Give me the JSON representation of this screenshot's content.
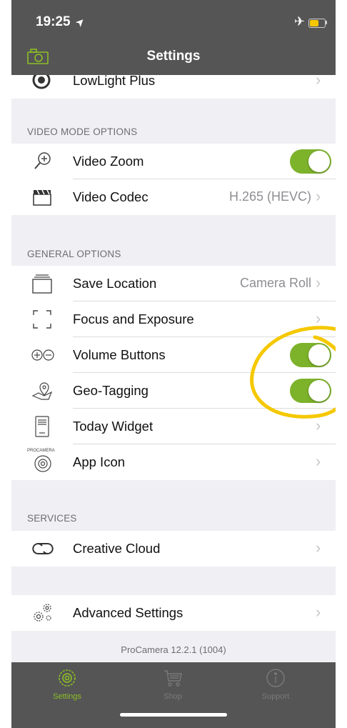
{
  "status_bar": {
    "time": "19:25",
    "location_glyph": "➤",
    "airplane_glyph": "✈"
  },
  "nav": {
    "title": "Settings",
    "left_icon": "camera-icon"
  },
  "partial_row": {
    "label": "LowLight Plus"
  },
  "sections": {
    "video": {
      "header": "VIDEO MODE OPTIONS",
      "zoom_label": "Video Zoom",
      "zoom_on": true,
      "codec_label": "Video Codec",
      "codec_value": "H.265 (HEVC)"
    },
    "general": {
      "header": "GENERAL OPTIONS",
      "save_label": "Save Location",
      "save_value": "Camera Roll",
      "focus_label": "Focus and Exposure",
      "volume_label": "Volume Buttons",
      "volume_on": true,
      "geo_label": "Geo-Tagging",
      "geo_on": true,
      "widget_label": "Today Widget",
      "appicon_label": "App Icon",
      "appicon_badge": "PROCAMERA"
    },
    "services": {
      "header": "SERVICES",
      "cc_label": "Creative Cloud"
    },
    "advanced": {
      "label": "Advanced Settings"
    }
  },
  "version": "ProCamera 12.2.1 (1004)",
  "tabbar": {
    "settings": "Settings",
    "shop": "Shop",
    "support": "Support",
    "active_color": "#8cbf26",
    "inactive_color": "#7a7a7a"
  },
  "chevron": "›",
  "colors": {
    "toggle_on": "#7db22b",
    "annotation": "#f5c800",
    "header_bg": "#555555"
  }
}
